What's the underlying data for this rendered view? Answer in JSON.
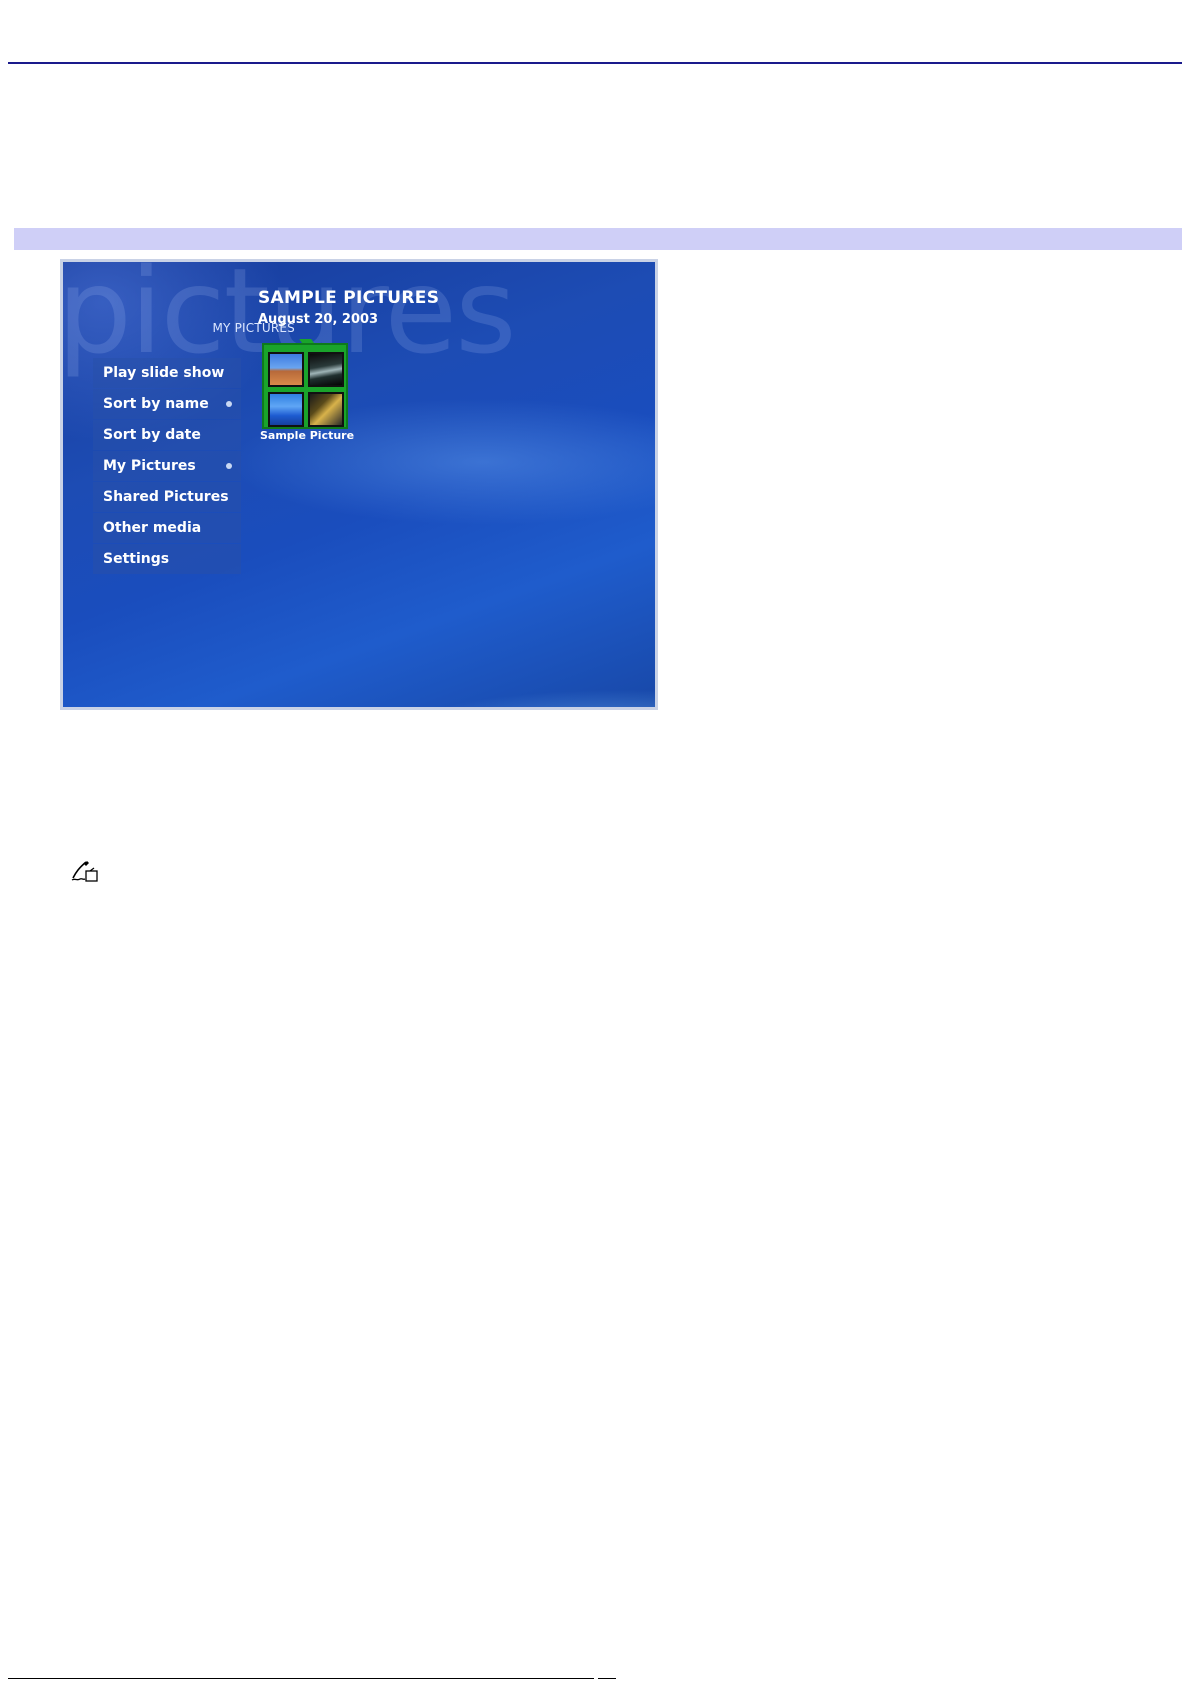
{
  "media_center": {
    "watermark": "pictures",
    "location": "MY PICTURES",
    "menu": [
      {
        "label": "Play slide show",
        "marker": false
      },
      {
        "label": "Sort by name",
        "marker": true
      },
      {
        "label": "Sort by date",
        "marker": false
      },
      {
        "label": "My Pictures",
        "marker": true
      },
      {
        "label": "Shared Pictures",
        "marker": false
      },
      {
        "label": "Other media",
        "marker": false
      },
      {
        "label": "Settings",
        "marker": false
      }
    ],
    "title": "SAMPLE PICTURES",
    "date": "August 20, 2003",
    "folder": {
      "label": "Sample Picture",
      "icon": "folder-icon"
    }
  },
  "note": {
    "icon": "note-pencil-icon"
  },
  "colors": {
    "rule": "#1a1a8c",
    "band": "#cfcff7",
    "folder": "#1aa42b"
  }
}
